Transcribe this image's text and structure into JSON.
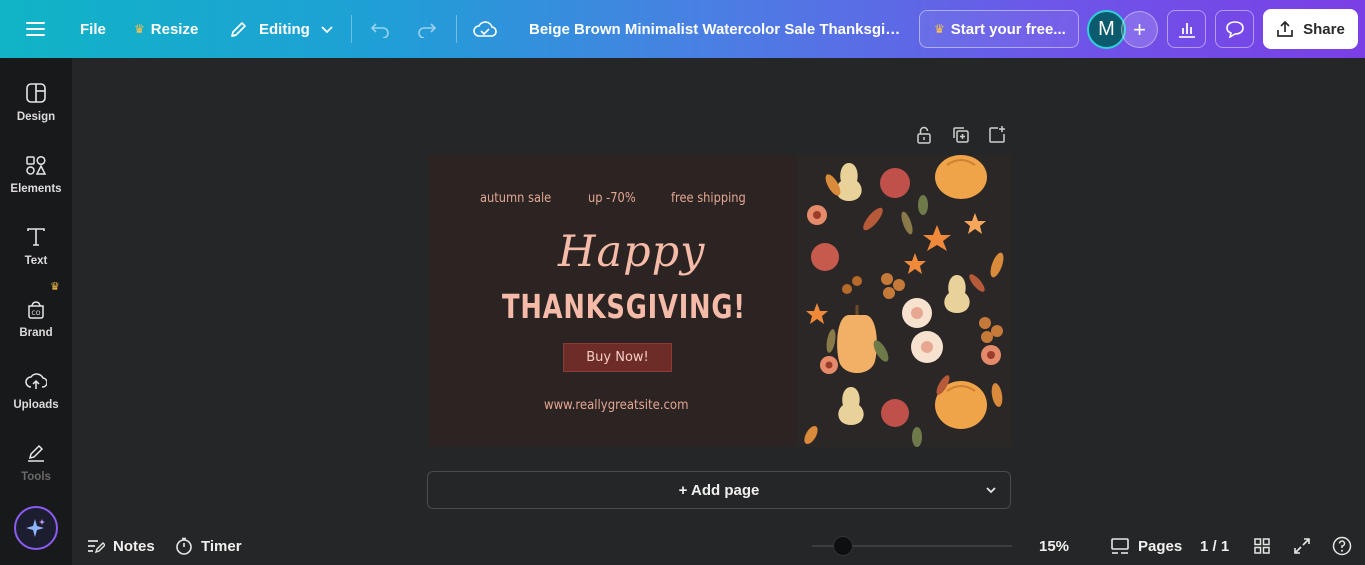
{
  "topbar": {
    "file": "File",
    "resize": "Resize",
    "editing": "Editing",
    "title": "Beige Brown Minimalist Watercolor Sale Thanksgivin...",
    "start_trial": "Start your free...",
    "avatar_initial": "M",
    "share": "Share"
  },
  "sidebar": {
    "items": [
      {
        "label": "Design",
        "icon": "design-icon"
      },
      {
        "label": "Elements",
        "icon": "elements-icon"
      },
      {
        "label": "Text",
        "icon": "text-icon"
      },
      {
        "label": "Brand",
        "icon": "brand-icon"
      },
      {
        "label": "Uploads",
        "icon": "uploads-icon"
      },
      {
        "label": "Tools",
        "icon": "tools-icon"
      }
    ]
  },
  "design": {
    "autumn_sale": "autumn sale",
    "discount": "up -70%",
    "shipping": "free shipping",
    "happy": "Happy",
    "thanksgiving": "THANKSGIVING!",
    "buy_now": "Buy Now!",
    "url": "www.reallygreatsite.com"
  },
  "canvas": {
    "add_page": "+ Add page"
  },
  "bottombar": {
    "notes": "Notes",
    "timer": "Timer",
    "zoom": "15%",
    "pages": "Pages",
    "page_count": "1 / 1"
  },
  "colors": {
    "accent_gradient_start": "#10b4c6",
    "accent_gradient_end": "#7a3fe6",
    "crown": "#ffc24a",
    "design_bg": "#2c2422",
    "design_text": "#f6bba8",
    "buy_button": "#6e2c28"
  }
}
